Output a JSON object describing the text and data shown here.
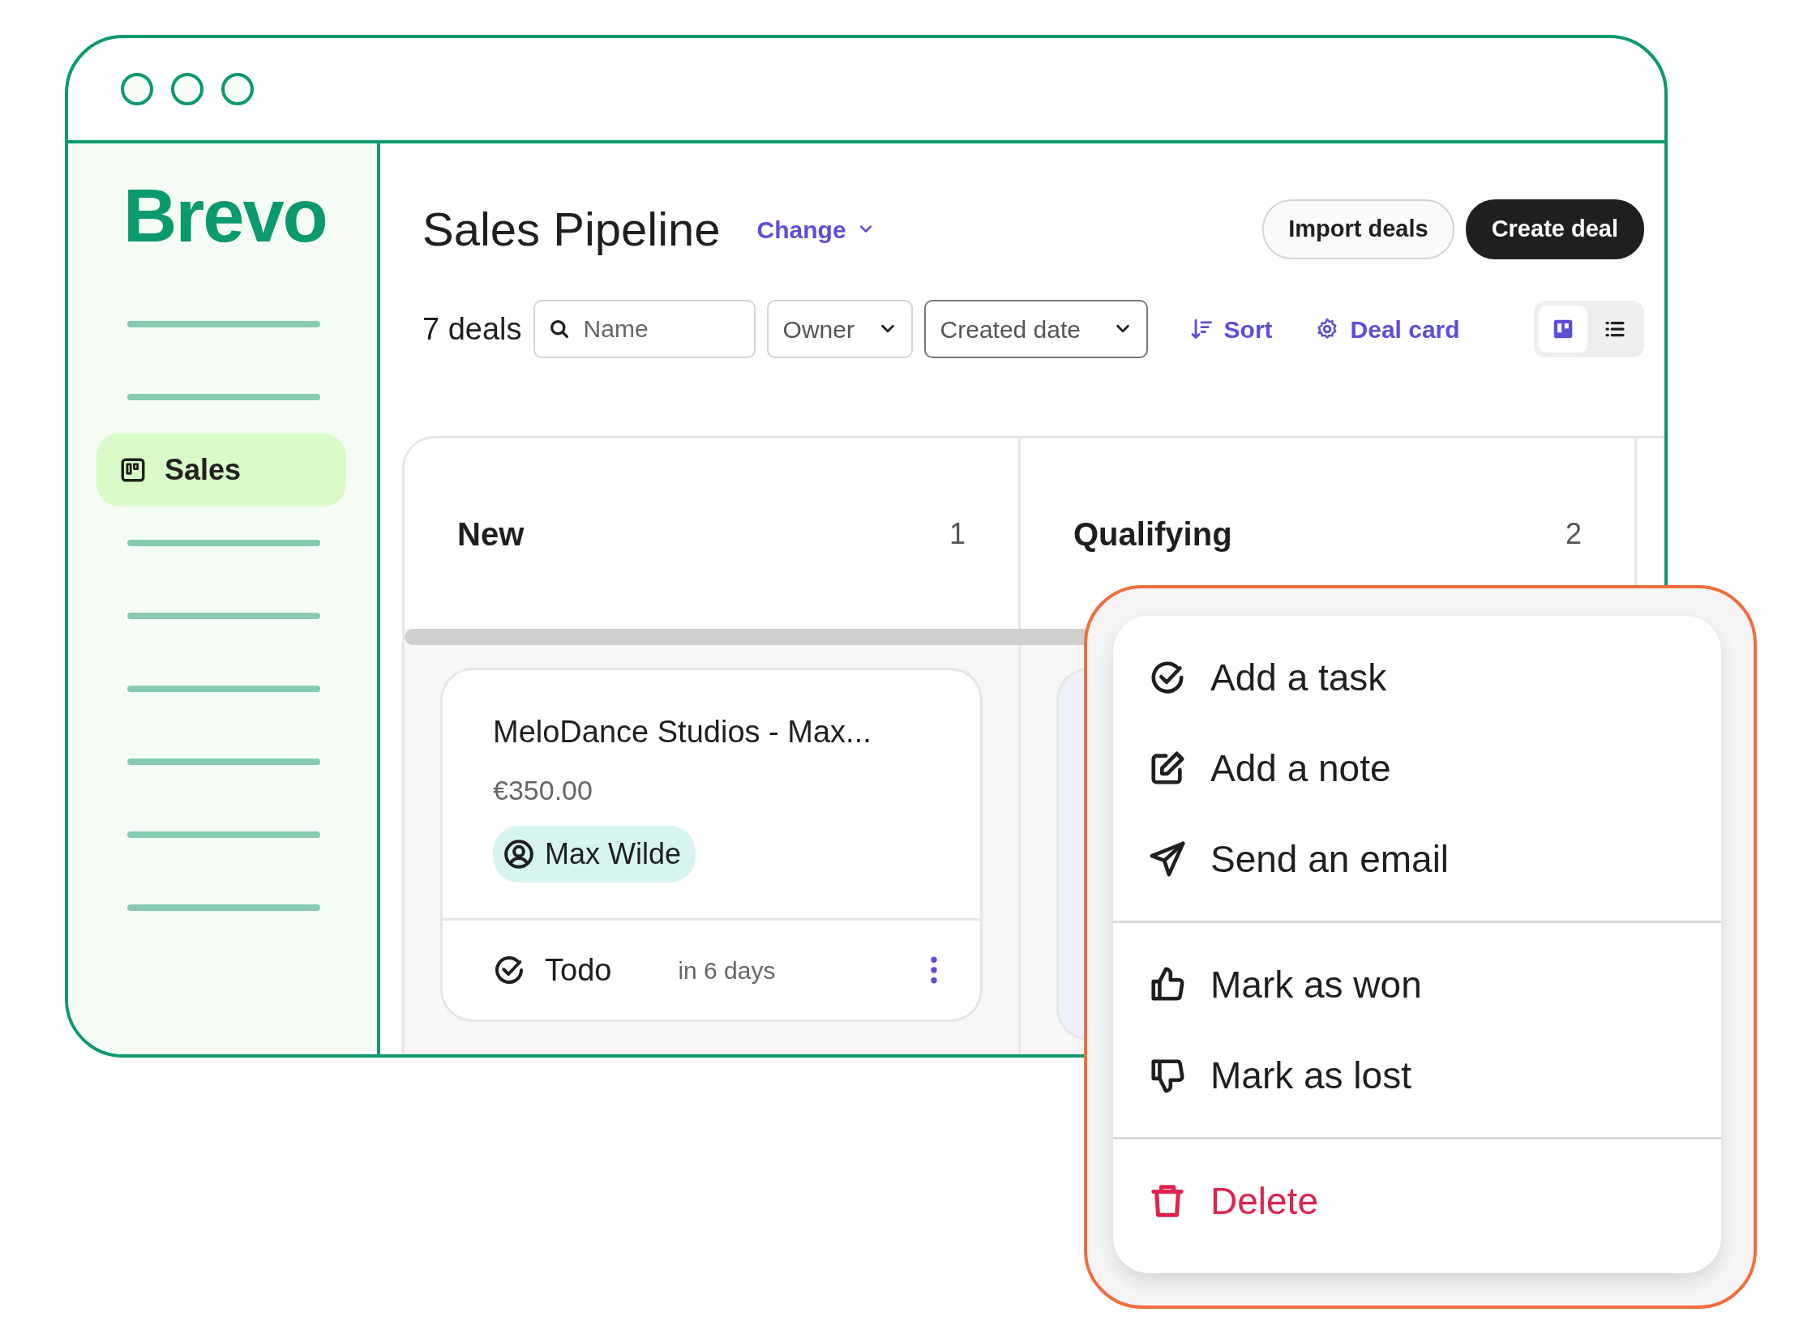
{
  "sidebar": {
    "logo": "Brevo",
    "items": [
      {
        "kind": "placeholder",
        "selected": false
      },
      {
        "kind": "placeholder",
        "selected": false
      },
      {
        "kind": "link",
        "label": "Sales",
        "selected": true
      },
      {
        "kind": "placeholder",
        "selected": false
      },
      {
        "kind": "placeholder",
        "selected": false
      },
      {
        "kind": "placeholder",
        "selected": false
      },
      {
        "kind": "placeholder",
        "selected": false
      },
      {
        "kind": "placeholder",
        "selected": false
      },
      {
        "kind": "placeholder",
        "selected": false
      }
    ]
  },
  "header": {
    "title": "Sales Pipeline",
    "switcher": "Change",
    "buttons": [
      {
        "label": "Import deals",
        "kind": "secondary"
      },
      {
        "label": "Create deal",
        "kind": "primary"
      }
    ]
  },
  "filters": {
    "count": "7 deals",
    "search": {
      "placeholder": "Name"
    },
    "selects": [
      {
        "label": "Owner",
        "focused": false
      },
      {
        "label": "Created date",
        "focused": true
      }
    ],
    "actions": [
      {
        "label": "Sort",
        "kind": "sort"
      },
      {
        "label": "Deal card",
        "kind": "settings"
      }
    ],
    "view_toggle": [
      {
        "kind": "board",
        "selected": true
      },
      {
        "kind": "list",
        "selected": false
      }
    ]
  },
  "columns": [
    {
      "title": "New",
      "count": "1",
      "cards": [
        {
          "covered": false,
          "title": "MeloDance Studios - Max...",
          "amount": "€350.00",
          "owner": "Max Wilde",
          "task": "Todo",
          "due": "in 6 days"
        }
      ]
    },
    {
      "title": "Qualifying",
      "count": "2",
      "cards": [
        {
          "covered": true
        }
      ]
    }
  ],
  "menu": {
    "groups": [
      [
        {
          "label": "Add a task",
          "kind": "task"
        },
        {
          "label": "Add a note",
          "kind": "note"
        },
        {
          "label": "Send an email",
          "kind": "email"
        }
      ],
      [
        {
          "label": "Mark as won",
          "kind": "won"
        },
        {
          "label": "Mark as lost",
          "kind": "lost"
        }
      ],
      [
        {
          "label": "Delete",
          "kind": "delete"
        }
      ]
    ]
  }
}
